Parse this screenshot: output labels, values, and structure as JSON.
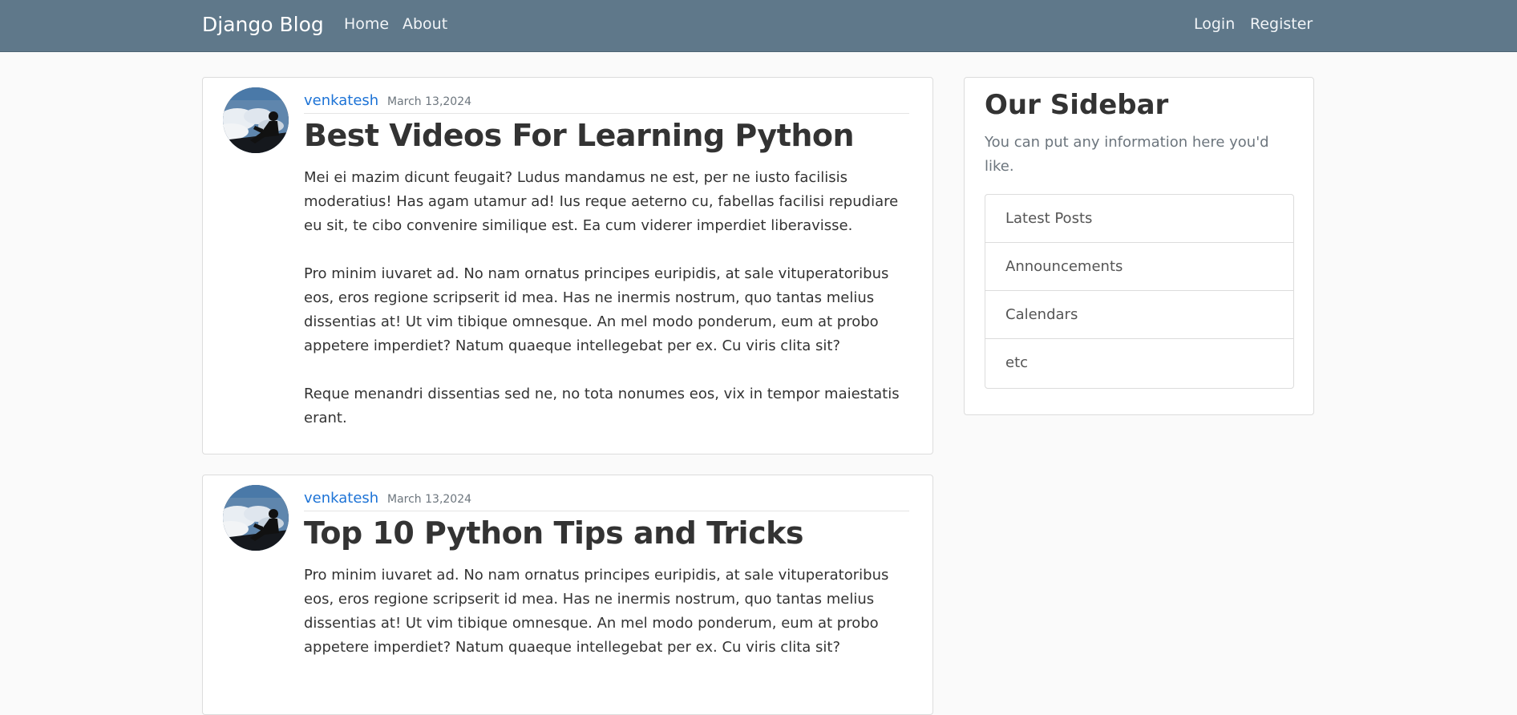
{
  "navbar": {
    "brand": "Django Blog",
    "left_links": [
      "Home",
      "About"
    ],
    "right_links": [
      "Login",
      "Register"
    ],
    "background": "#5f788a"
  },
  "posts": [
    {
      "author": "venkatesh",
      "date": "March 13,2024",
      "title": "Best Videos For Learning Python",
      "paragraphs": [
        "Mei ei mazim dicunt feugait? Ludus mandamus ne est, per ne iusto facilisis moderatius! Has agam utamur ad! Ius reque aeterno cu, fabellas facilisi repudiare eu sit, te cibo convenire similique est. Ea cum viderer imperdiet liberavisse.",
        "Pro minim iuvaret ad. No nam ornatus principes euripidis, at sale vituperatoribus eos, eros regione scripserit id mea. Has ne inermis nostrum, quo tantas melius dissentias at! Ut vim tibique omnesque. An mel modo ponderum, eum at probo appetere imperdiet? Natum quaeque intellegebat per ex. Cu viris clita sit?",
        "Reque menandri dissentias sed ne, no tota nonumes eos, vix in tempor maiestatis erant."
      ]
    },
    {
      "author": "venkatesh",
      "date": "March 13,2024",
      "title": "Top 10 Python Tips and Tricks",
      "paragraphs": [
        "Pro minim iuvaret ad. No nam ornatus principes euripidis, at sale vituperatoribus eos, eros regione scripserit id mea. Has ne inermis nostrum, quo tantas melius dissentias at! Ut vim tibique omnesque. An mel modo ponderum, eum at probo appetere imperdiet? Natum quaeque intellegebat per ex. Cu viris clita sit?"
      ]
    }
  ],
  "sidebar": {
    "title": "Our Sidebar",
    "text": "You can put any information here you'd like.",
    "items": [
      "Latest Posts",
      "Announcements",
      "Calendars",
      "etc"
    ]
  },
  "icons": {
    "avatar": "profile-avatar-icon"
  },
  "colors": {
    "accent": "#1d73d6",
    "background": "#fafafa"
  }
}
